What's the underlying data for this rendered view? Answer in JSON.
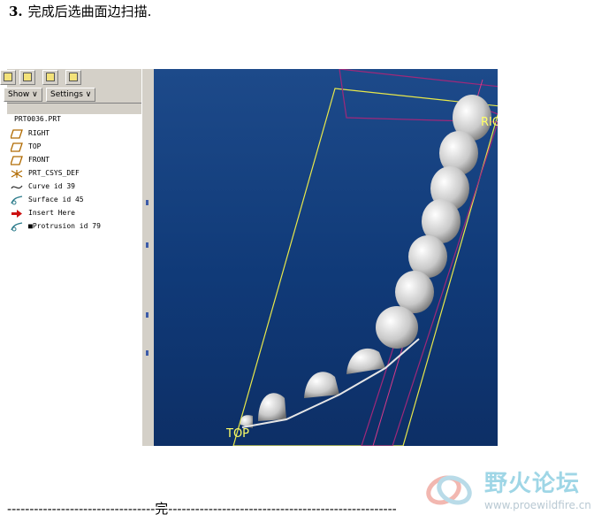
{
  "heading": {
    "number": "3.",
    "text": "完成后选曲面边扫描."
  },
  "model_tree": {
    "menu": {
      "show_label": "Show ∨",
      "settings_label": "Settings ∨"
    },
    "root": "PRT0036.PRT",
    "items": [
      {
        "label": "RIGHT",
        "icon": "datum-plane-icon"
      },
      {
        "label": "TOP",
        "icon": "datum-plane-icon"
      },
      {
        "label": "FRONT",
        "icon": "datum-plane-icon"
      },
      {
        "label": "PRT_CSYS_DEF",
        "icon": "csys-icon"
      },
      {
        "label": "Curve id 39",
        "icon": "curve-icon"
      },
      {
        "label": "Surface id 45",
        "icon": "surface-icon"
      },
      {
        "label": "Insert Here",
        "icon": "insert-arrow-icon"
      },
      {
        "label": "■Protrusion id 79",
        "icon": "protrusion-icon"
      }
    ]
  },
  "viewport": {
    "label_right": "RIG",
    "label_top": "TOP"
  },
  "footer": {
    "text": "---------------------------------完---------------------------------------------------"
  },
  "watermark": {
    "title": "野火论坛",
    "url": "www.proewildfire.cn"
  },
  "colors": {
    "viewport": "#103a78",
    "datum": "#ffff66",
    "accent": "#9fd6e6"
  }
}
